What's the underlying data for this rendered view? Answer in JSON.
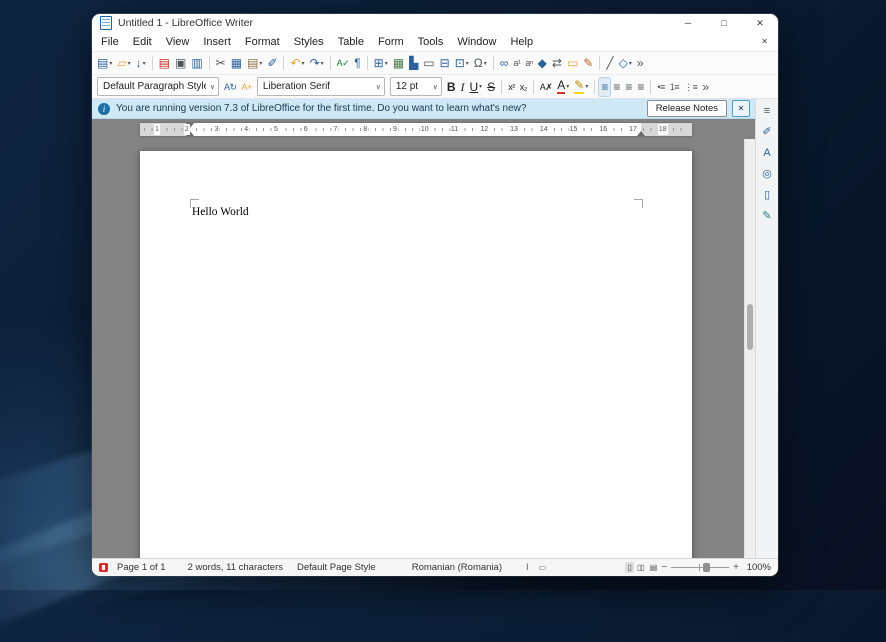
{
  "ui": {
    "dropdown_arrow": "▾",
    "combo_arrow": "∨"
  },
  "window": {
    "title": "Untitled 1 - LibreOffice Writer",
    "controls": {
      "minimize": "─",
      "maximize": "□",
      "close": "✕"
    }
  },
  "menu": {
    "items": [
      "File",
      "Edit",
      "View",
      "Insert",
      "Format",
      "Styles",
      "Table",
      "Form",
      "Tools",
      "Window",
      "Help"
    ],
    "close": "✕"
  },
  "standard_toolbar": {
    "items": [
      {
        "name": "new-document",
        "glyph": "▤",
        "color": "#2a6099",
        "dd": true
      },
      {
        "name": "open-file",
        "glyph": "▱",
        "color": "#e8a33d",
        "dd": true
      },
      {
        "name": "save",
        "glyph": "↓",
        "color": "#2a6099",
        "dd": true
      },
      {
        "sep": true
      },
      {
        "name": "export-pdf",
        "glyph": "▤",
        "color": "#c9211e"
      },
      {
        "name": "print",
        "glyph": "▣",
        "color": "#50555a"
      },
      {
        "name": "print-preview",
        "glyph": "▥",
        "color": "#2a6099"
      },
      {
        "sep": true
      },
      {
        "name": "cut",
        "glyph": "✂",
        "color": "#50555a"
      },
      {
        "name": "copy",
        "glyph": "▦",
        "color": "#2a6099"
      },
      {
        "name": "paste",
        "glyph": "▤",
        "color": "#8a6d3b",
        "dd": true
      },
      {
        "name": "clone-formatting",
        "glyph": "✐",
        "color": "#2a6099"
      },
      {
        "sep": true
      },
      {
        "name": "undo",
        "glyph": "↶",
        "color": "#e8a33d",
        "dd": true
      },
      {
        "name": "redo",
        "glyph": "↷",
        "color": "#2a6099",
        "dd": true
      },
      {
        "sep": true
      },
      {
        "name": "spelling",
        "glyph": "A✓",
        "cls": "g-sm",
        "color": "#1a7f37"
      },
      {
        "name": "formatting-marks",
        "glyph": "¶",
        "color": "#2a6099"
      },
      {
        "sep": true
      },
      {
        "name": "insert-table",
        "glyph": "⊞",
        "color": "#2a6099",
        "dd": true
      },
      {
        "name": "insert-image",
        "glyph": "▦",
        "color": "#4a7d4a"
      },
      {
        "name": "insert-chart",
        "glyph": "▙",
        "color": "#2a6099"
      },
      {
        "name": "insert-text-box",
        "glyph": "▭",
        "color": "#50555a"
      },
      {
        "name": "insert-page-break",
        "glyph": "⊟",
        "color": "#2a6099"
      },
      {
        "name": "insert-field",
        "glyph": "⊡",
        "color": "#2a6099",
        "dd": true
      },
      {
        "name": "insert-special-character",
        "glyph": "Ω",
        "color": "#50555a",
        "dd": true
      },
      {
        "sep": true
      },
      {
        "name": "insert-hyperlink",
        "glyph": "∞",
        "color": "#2a6099"
      },
      {
        "name": "insert-footnote",
        "glyph": "a¹",
        "cls": "g-sm",
        "color": "#50555a"
      },
      {
        "name": "insert-endnote",
        "glyph": "aⁿ",
        "cls": "g-sm",
        "color": "#50555a"
      },
      {
        "name": "insert-bookmark",
        "glyph": "◆",
        "color": "#2a6099"
      },
      {
        "name": "insert-cross-reference",
        "glyph": "⇄",
        "color": "#50555a"
      },
      {
        "name": "insert-comment",
        "glyph": "▭",
        "color": "#e8a33d"
      },
      {
        "name": "track-changes",
        "glyph": "✎",
        "color": "#b5651d"
      },
      {
        "sep": true
      },
      {
        "name": "insert-line",
        "glyph": "╱",
        "color": "#50555a"
      },
      {
        "name": "basic-shapes",
        "glyph": "◇",
        "color": "#2a6099",
        "dd": true
      },
      {
        "name": "toolbar-overflow",
        "glyph": "»",
        "color": "#50555a"
      }
    ]
  },
  "formatting_toolbar": {
    "paragraph_style": "Default Paragraph Style",
    "font_name": "Liberation Serif",
    "font_size": "12 pt",
    "style_buttons": [
      {
        "name": "update-style",
        "glyph": "A↻",
        "cls": "g-sm",
        "color": "#2a6099"
      },
      {
        "name": "new-style",
        "glyph": "A+",
        "cls": "g-sm",
        "color": "#e8a33d"
      }
    ],
    "buttons": [
      {
        "name": "bold",
        "glyph": "B",
        "cls": "g-bold",
        "color": "#222222"
      },
      {
        "name": "italic",
        "glyph": "I",
        "cls": "g-italic",
        "color": "#222222"
      },
      {
        "name": "underline",
        "glyph": "U",
        "cls": "g-underline",
        "color": "#222222",
        "dd": true
      },
      {
        "name": "strikethrough",
        "glyph": "S",
        "cls": "g-strike",
        "color": "#222222"
      },
      {
        "sep": true
      },
      {
        "name": "superscript",
        "glyph": "x²",
        "cls": "g-sm",
        "color": "#222222"
      },
      {
        "name": "subscript",
        "glyph": "x₂",
        "cls": "g-sm",
        "color": "#222222"
      },
      {
        "sep": true
      },
      {
        "name": "clear-formatting",
        "glyph": "A✗",
        "cls": "g-sm",
        "color": "#222222"
      },
      {
        "name": "font-color",
        "glyph": "A",
        "cls": "g-fontcolor",
        "color": "#222222",
        "dd": true
      },
      {
        "name": "highlight-color",
        "glyph": "✎",
        "cls": "g-highlight",
        "color": "#b58900",
        "dd": true
      },
      {
        "sep": true
      },
      {
        "name": "align-left",
        "glyph": "≡",
        "color": "#2a6099",
        "active": true
      },
      {
        "name": "align-center",
        "glyph": "≡",
        "color": "#50555a"
      },
      {
        "name": "align-right",
        "glyph": "≡",
        "color": "#50555a"
      },
      {
        "name": "align-justified",
        "glyph": "≡",
        "color": "#50555a"
      },
      {
        "sep": true
      },
      {
        "name": "unordered-list",
        "glyph": "•≡",
        "cls": "g-sm",
        "color": "#50555a"
      },
      {
        "name": "ordered-list",
        "glyph": "1≡",
        "cls": "g-sm",
        "color": "#50555a"
      },
      {
        "name": "outline-list",
        "glyph": "⋮≡",
        "cls": "g-sm",
        "color": "#50555a"
      },
      {
        "name": "toolbar-overflow",
        "glyph": "»",
        "color": "#50555a"
      }
    ]
  },
  "infobar": {
    "message": "You are running version 7.3 of LibreOffice for the first time. Do you want to learn what's new?",
    "release_notes_label": "Release Notes",
    "close": "✕"
  },
  "ruler": {
    "numbers": [
      "1",
      "2",
      "3",
      "4",
      "5",
      "6",
      "7",
      "8",
      "9",
      "10",
      "11",
      "12",
      "13",
      "14",
      "15",
      "16",
      "17",
      "18"
    ]
  },
  "document": {
    "text": "Hello World"
  },
  "sidebar": {
    "tabs": [
      {
        "name": "sidebar-settings",
        "glyph": "≡",
        "color": "#50555a"
      },
      {
        "name": "properties",
        "glyph": "✐",
        "color": "#2a6099"
      },
      {
        "name": "styles",
        "glyph": "A",
        "color": "#2a6099"
      },
      {
        "name": "navigator",
        "glyph": "◎",
        "color": "#2a6099"
      },
      {
        "name": "page",
        "glyph": "▯",
        "color": "#2a6099"
      },
      {
        "name": "style-inspector",
        "glyph": "✎",
        "color": "#1f7a8c"
      }
    ]
  },
  "statusbar": {
    "page": "Page 1 of 1",
    "word_count": "2 words, 11 characters",
    "page_style": "Default Page Style",
    "language": "Romanian (Romania)",
    "insert_mode_glyph": "I",
    "selection_mode_glyph": "▭",
    "view_single": "▯",
    "view_multi": "▯▯",
    "view_book": "▤",
    "zoom_out": "−",
    "zoom_in": "+",
    "zoom_level": "100%"
  }
}
